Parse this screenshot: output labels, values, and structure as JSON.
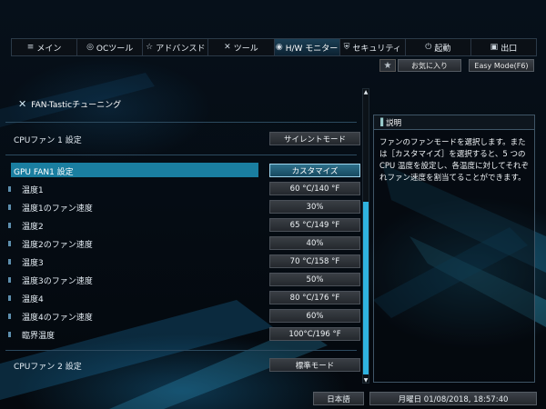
{
  "tabs": [
    {
      "icon": "≡",
      "label": "メイン"
    },
    {
      "icon": "◎",
      "label": "OCツール"
    },
    {
      "icon": "☆",
      "label": "アドバンスド"
    },
    {
      "icon": "✕",
      "label": "ツール"
    },
    {
      "icon": "◉",
      "label": "H/W モニター"
    },
    {
      "icon": "⛨",
      "label": "セキュリティ"
    },
    {
      "icon": "⏻",
      "label": "起動"
    },
    {
      "icon": "▣",
      "label": "出口"
    }
  ],
  "favorites_label": "お気に入り",
  "easy_mode_label": "Easy Mode(F6)",
  "section_title": "FAN-Tasticチューニング",
  "cpu_fan1_label": "CPUファン 1 設定",
  "cpu_fan1_value": "サイレントモード",
  "gpu_fan1_label": "GPU FAN1 設定",
  "gpu_fan1_value": "カスタマイズ",
  "rows": [
    {
      "label": "温度1",
      "value": "60 °C/140 °F"
    },
    {
      "label": "温度1のファン速度",
      "value": "30%"
    },
    {
      "label": "温度2",
      "value": "65 °C/149 °F"
    },
    {
      "label": "温度2のファン速度",
      "value": "40%"
    },
    {
      "label": "温度3",
      "value": "70 °C/158 °F"
    },
    {
      "label": "温度3のファン速度",
      "value": "50%"
    },
    {
      "label": "温度4",
      "value": "80 °C/176 °F"
    },
    {
      "label": "温度4のファン速度",
      "value": "60%"
    },
    {
      "label": "臨界温度",
      "value": "100°C/196 °F"
    }
  ],
  "cpu_fan2_label": "CPUファン 2 設定",
  "cpu_fan2_value": "標準モード",
  "description": {
    "title": "説明",
    "text": "ファンのファンモードを選択します。または［カスタマイズ］を選択すると、5 つの CPU 温度を設定し、各温度に対してそれぞれファン速度を割当てることができます。"
  },
  "language": "日本語",
  "datetime": "月曜日 01/08/2018, 18:57:40",
  "colors": {
    "accent": "#1a7ea0",
    "scrollbar": "#2fb3e0"
  }
}
